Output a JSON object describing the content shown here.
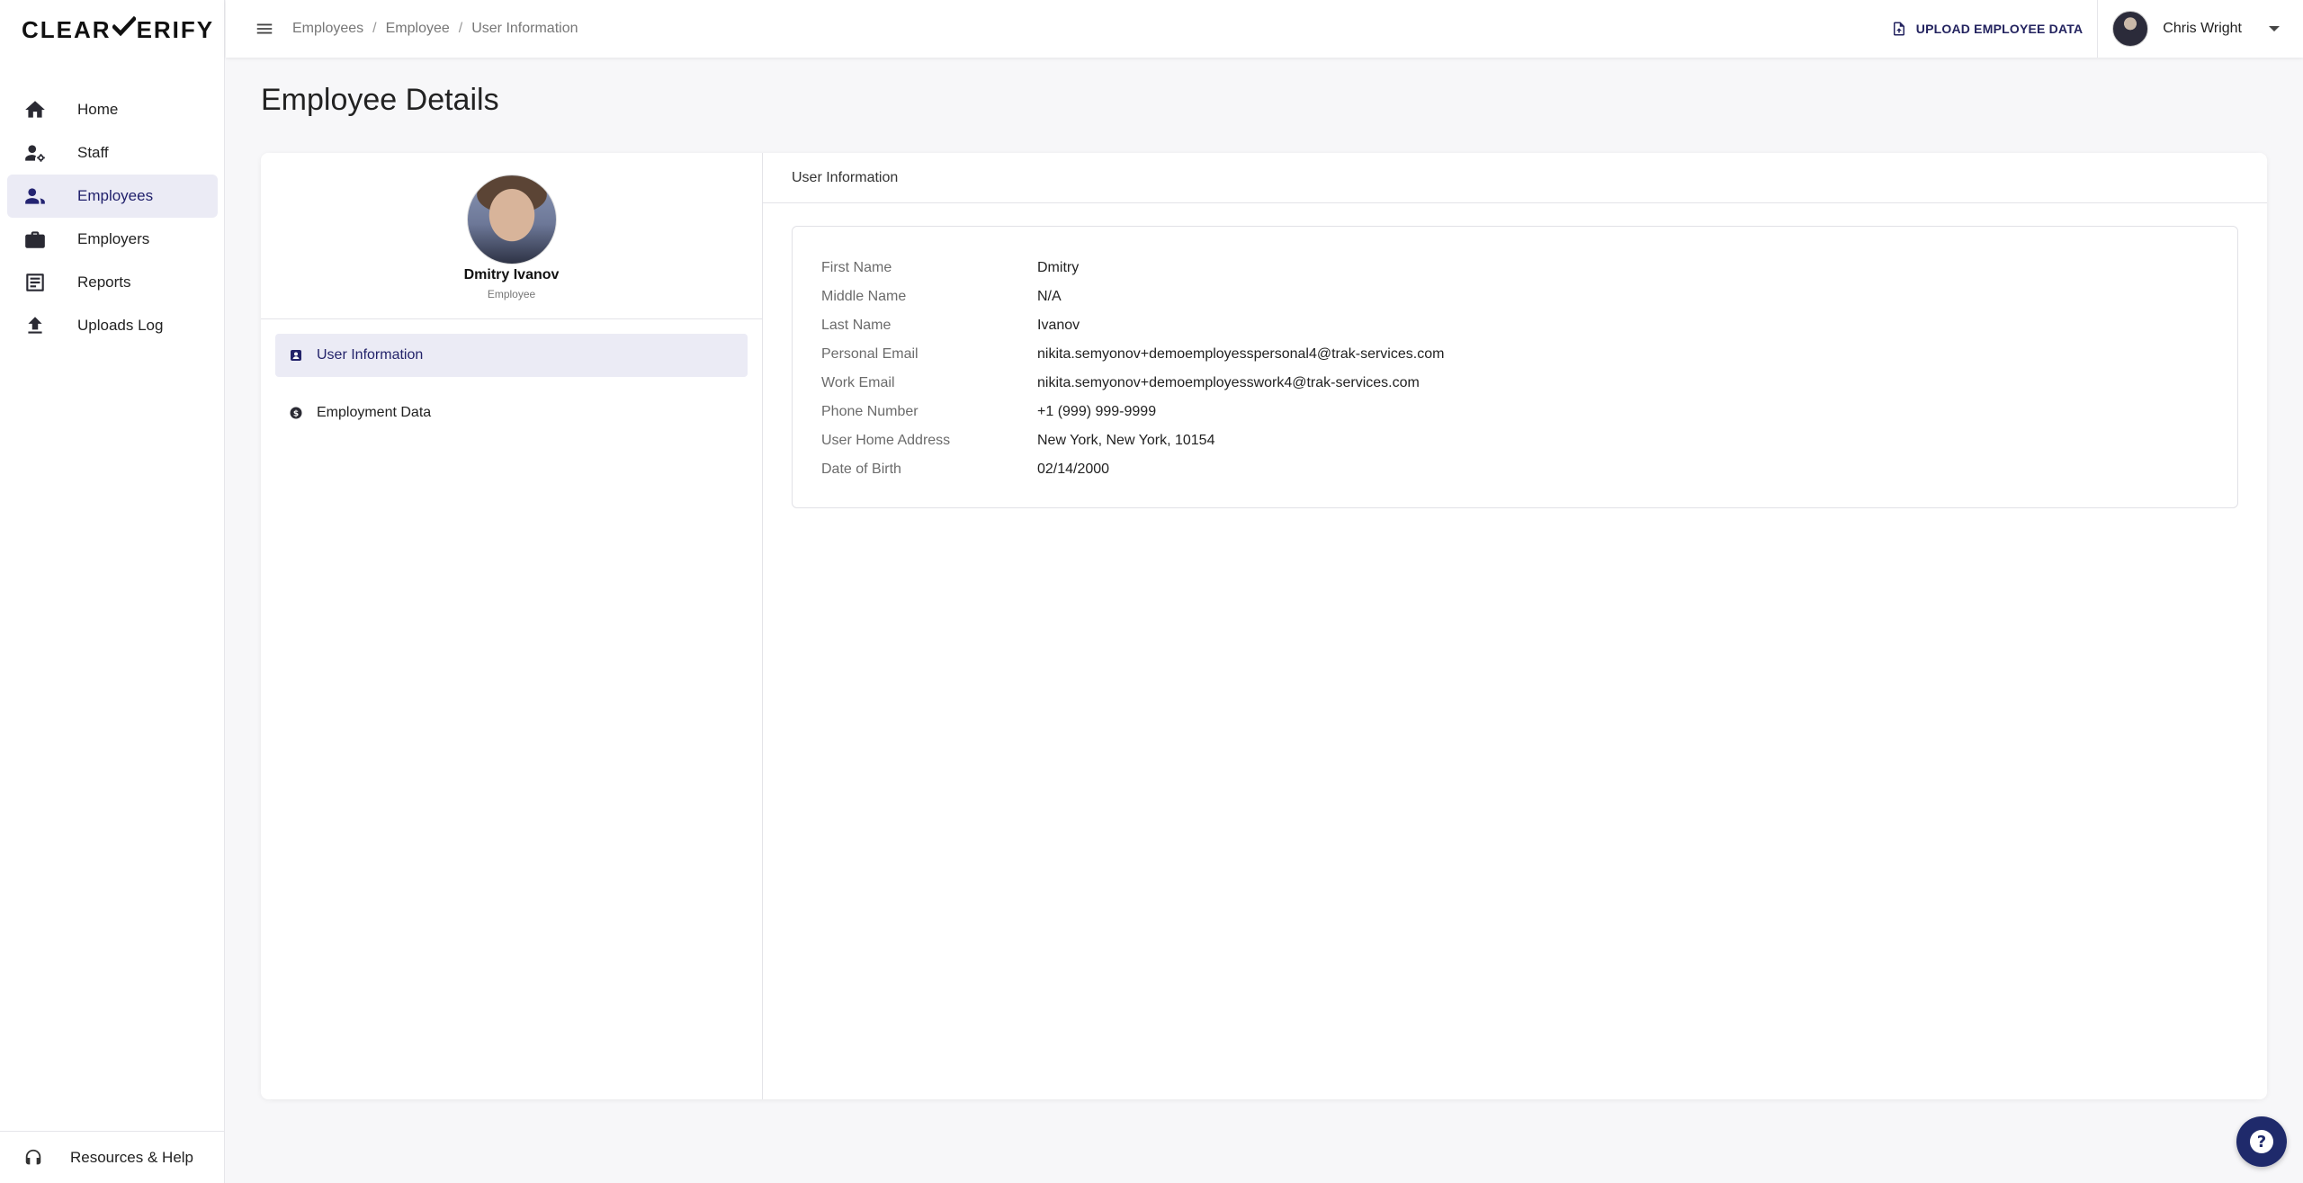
{
  "brand": {
    "logo_left": "CLEAR",
    "logo_right": "ERIFY"
  },
  "sidebar": {
    "items": [
      {
        "label": "Home",
        "icon": "home-icon"
      },
      {
        "label": "Staff",
        "icon": "staff-icon"
      },
      {
        "label": "Employees",
        "icon": "employees-icon"
      },
      {
        "label": "Employers",
        "icon": "briefcase-icon"
      },
      {
        "label": "Reports",
        "icon": "reports-icon"
      },
      {
        "label": "Uploads Log",
        "icon": "upload-icon"
      }
    ],
    "active_index": 2,
    "footer_label": "Resources & Help"
  },
  "topbar": {
    "breadcrumb": [
      "Employees",
      "Employee",
      "User Information"
    ],
    "upload_label": "UPLOAD EMPLOYEE DATA",
    "user_name": "Chris Wright"
  },
  "page": {
    "title": "Employee Details"
  },
  "profile": {
    "name": "Dmitry Ivanov",
    "role": "Employee"
  },
  "side_menu": {
    "items": [
      {
        "label": "User Information",
        "icon": "contact-card-icon"
      },
      {
        "label": "Employment Data",
        "icon": "dollar-icon"
      }
    ]
  },
  "user_info": {
    "header": "User Information",
    "fields": [
      {
        "label": "First Name",
        "value": "Dmitry"
      },
      {
        "label": "Middle Name",
        "value": "N/A"
      },
      {
        "label": "Last Name",
        "value": "Ivanov"
      },
      {
        "label": "Personal Email",
        "value": "nikita.semyonov+demoemployesspersonal4@trak-services.com"
      },
      {
        "label": "Work Email",
        "value": "nikita.semyonov+demoemployesswork4@trak-services.com"
      },
      {
        "label": "Phone Number",
        "value": "+1 (999) 999-9999"
      },
      {
        "label": "User Home Address",
        "value": "New York, New York, 10154"
      },
      {
        "label": "Date of Birth",
        "value": "02/14/2000"
      }
    ]
  },
  "colors": {
    "accent": "#23236a",
    "active_bg": "#ebebf5",
    "fab": "#1f2a6b"
  }
}
